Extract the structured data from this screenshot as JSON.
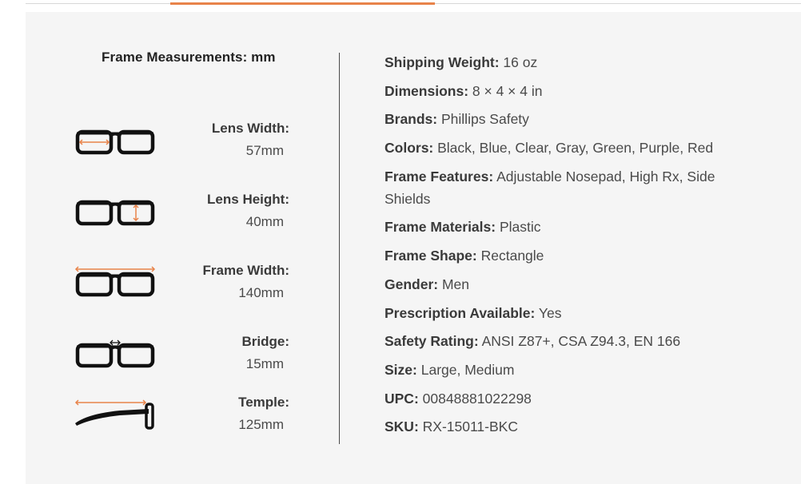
{
  "measurements": {
    "title": "Frame Measurements: mm",
    "items": [
      {
        "label": "Lens Width:",
        "value": "57mm",
        "icon": "lens-width-icon"
      },
      {
        "label": "Lens Height:",
        "value": "40mm",
        "icon": "lens-height-icon"
      },
      {
        "label": "Frame Width:",
        "value": "140mm",
        "icon": "frame-width-icon"
      },
      {
        "label": "Bridge:",
        "value": "15mm",
        "icon": "bridge-icon"
      },
      {
        "label": "Temple:",
        "value": "125mm",
        "icon": "temple-icon"
      }
    ]
  },
  "specs": [
    {
      "key": "Shipping Weight:",
      "value": "16 oz"
    },
    {
      "key": "Dimensions:",
      "value": "8 × 4 × 4 in"
    },
    {
      "key": "Brands:",
      "value": "Phillips Safety"
    },
    {
      "key": "Colors:",
      "value": "Black, Blue, Clear, Gray, Green, Purple, Red"
    },
    {
      "key": "Frame Features:",
      "value": "Adjustable Nosepad, High Rx, Side Shields"
    },
    {
      "key": "Frame Materials:",
      "value": "Plastic"
    },
    {
      "key": "Frame Shape:",
      "value": "Rectangle"
    },
    {
      "key": "Gender:",
      "value": "Men"
    },
    {
      "key": "Prescription Available:",
      "value": "Yes"
    },
    {
      "key": "Safety Rating:",
      "value": "ANSI Z87+, CSA Z94.3, EN 166"
    },
    {
      "key": "Size:",
      "value": "Large, Medium"
    },
    {
      "key": "UPC:",
      "value": "00848881022298"
    },
    {
      "key": "SKU:",
      "value": "RX-15011-BKC"
    }
  ],
  "colors": {
    "accent": "#e8834a",
    "panel_bg": "#f5f5f5",
    "frame": "#111111"
  }
}
